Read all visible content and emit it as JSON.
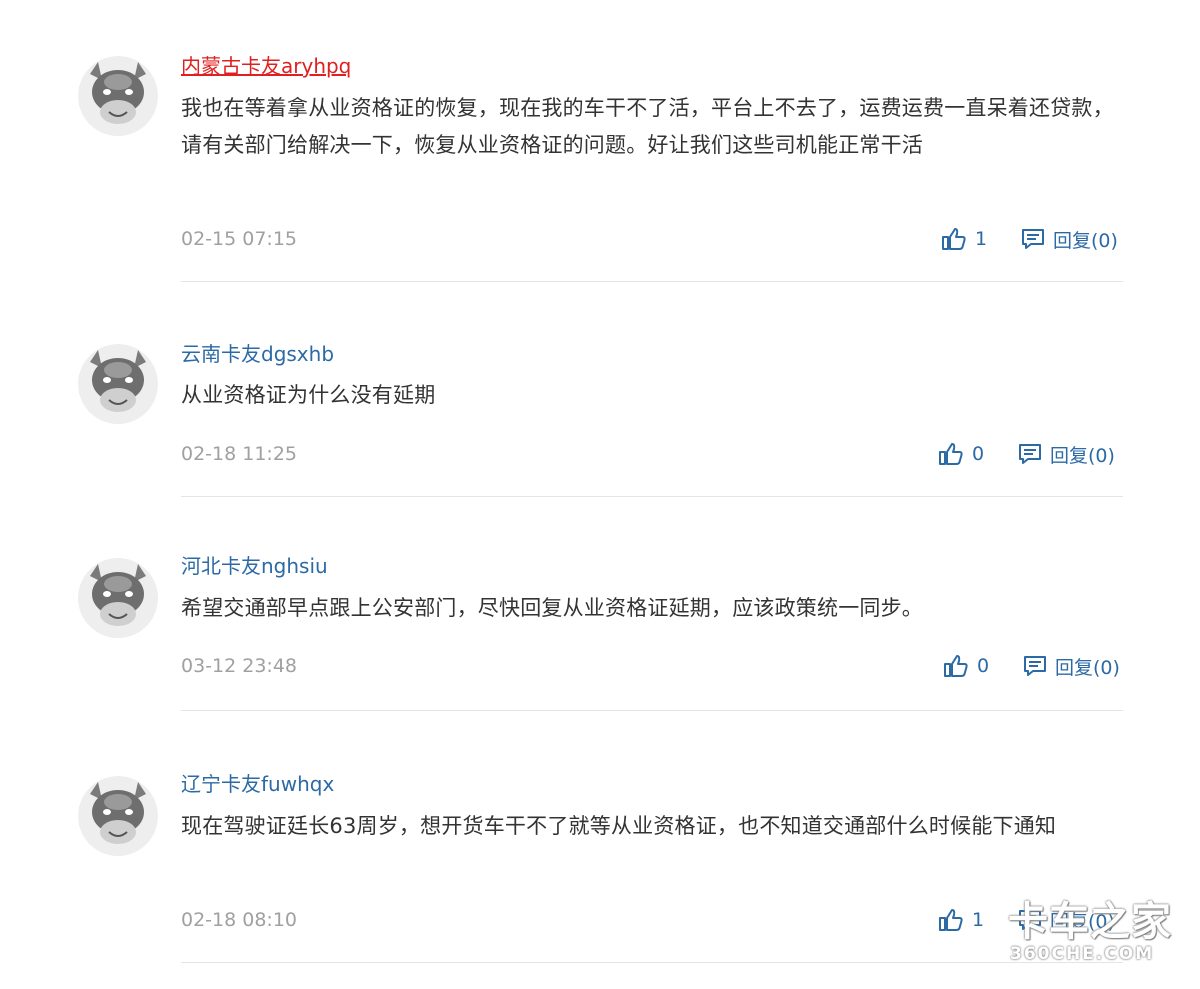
{
  "comments": [
    {
      "username": "内蒙古卡友aryhpq",
      "text": "我也在等着拿从业资格证的恢复，现在我的车干不了活，平台上不去了，运费运费一直呆着还贷款，请有关部门给解决一下，恢复从业资格证的问题。好让我们这些司机能正常干活",
      "time": "02-15 07:15",
      "likes": "1",
      "reply_label": "回复(0)"
    },
    {
      "username": "云南卡友dgsxhb",
      "text": "从业资格证为什么没有延期",
      "time": "02-18 11:25",
      "likes": "0",
      "reply_label": "回复(0)"
    },
    {
      "username": "河北卡友nghsiu",
      "text": "希望交通部早点跟上公安部门，尽快回复从业资格证延期，应该政策统一同步。",
      "time": "03-12 23:48",
      "likes": "0",
      "reply_label": "回复(0)"
    },
    {
      "username": "辽宁卡友fuwhqx",
      "text": "现在驾驶证廷长63周岁，想开货车干不了就等从业资格证，也不知道交通部什么时候能下通知",
      "time": "02-18 08:10",
      "likes": "1",
      "reply_label": "回复(0)"
    }
  ],
  "watermark": {
    "brand": "卡车之家",
    "domain": "360CHE.COM"
  },
  "colors": {
    "username": "#2c6aa6",
    "username_active": "#e02020",
    "text": "#333333",
    "time": "#a0a0a0",
    "action": "#2c6aa6"
  },
  "icons": {
    "avatar": "cow-avatar-icon",
    "like": "thumbs-up-icon",
    "reply": "comment-icon"
  }
}
